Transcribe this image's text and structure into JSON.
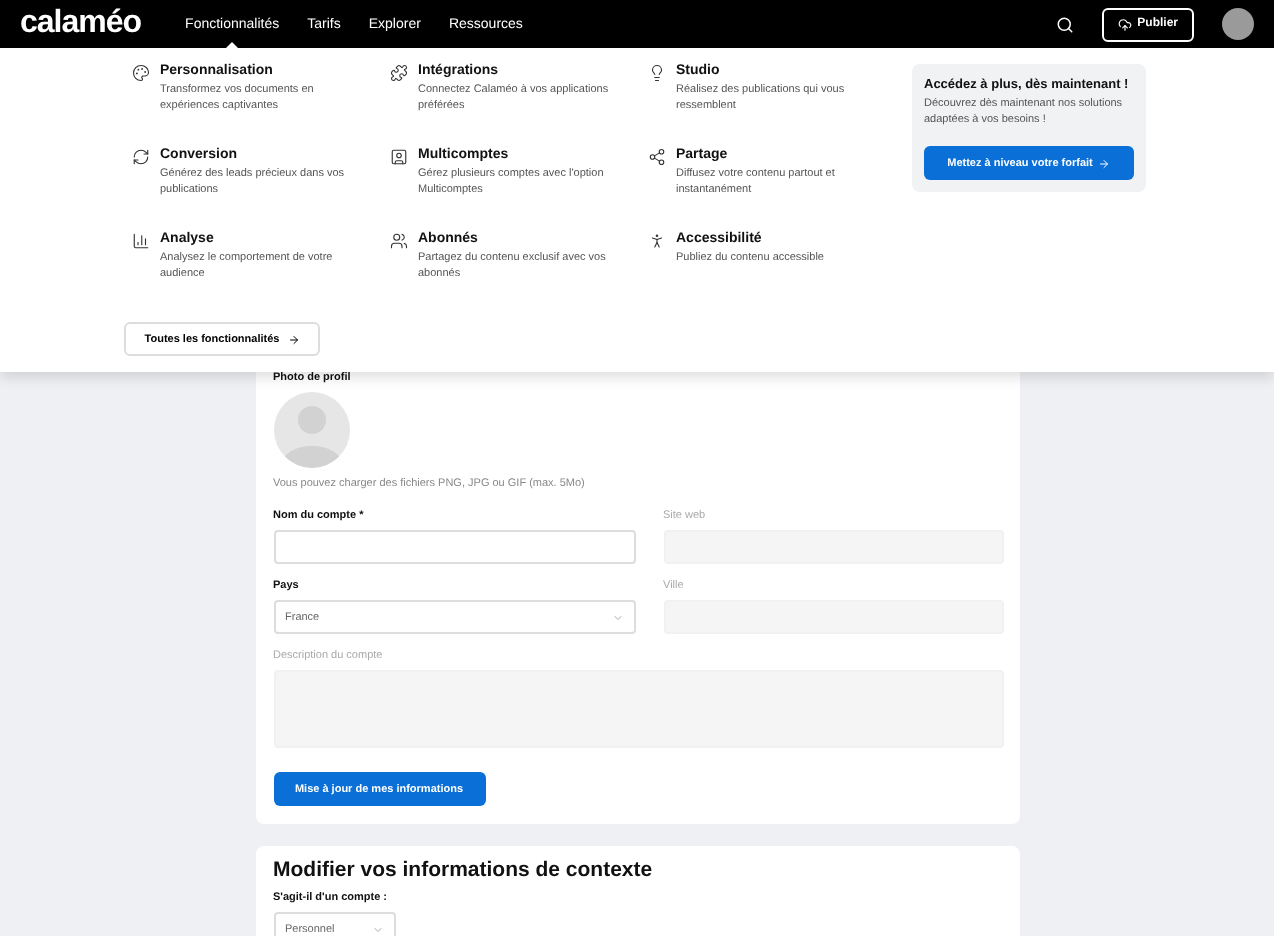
{
  "header": {
    "logo": "calaméo",
    "nav": [
      {
        "label": "Fonctionnalités",
        "selected": true
      },
      {
        "label": "Tarifs",
        "selected": false
      },
      {
        "label": "Explorer",
        "selected": false
      },
      {
        "label": "Ressources",
        "selected": false
      }
    ],
    "publish": "Publier"
  },
  "menu": {
    "columns": [
      [
        {
          "title": "Personnalisation",
          "text": "Transformez vos documents en expériences captivantes"
        },
        {
          "title": "Conversion",
          "text": "Générez des leads précieux dans vos publications"
        },
        {
          "title": "Analyse",
          "text": "Analysez le comportement de votre audience"
        }
      ],
      [
        {
          "title": "Intégrations",
          "text": "Connectez Calaméo à vos applications préférées"
        },
        {
          "title": "Multicomptes",
          "text": "Gérez plusieurs comptes avec l'option Multicomptes"
        },
        {
          "title": "Abonnés",
          "text": "Partagez du contenu exclusif avec vos abonnés"
        }
      ],
      [
        {
          "title": "Studio",
          "text": "Réalisez des publications qui vous ressemblent"
        },
        {
          "title": "Partage",
          "text": "Diffusez votre contenu partout et instantanément"
        },
        {
          "title": "Accessibilité",
          "text": "Publiez du contenu accessible"
        }
      ]
    ],
    "all": "Toutes les fonctionnalités",
    "promo": {
      "title": "Accédez à plus, dès maintenant !",
      "text": "Découvrez dès maintenant nos solutions adaptées à vos besoins !",
      "button": "Mettez à niveau votre forfait"
    }
  },
  "profile": {
    "photo_label": "Photo de profil",
    "photo_hint": "Vous pouvez charger des fichiers PNG, JPG ou GIF (max. 5Mo)",
    "fields": [
      {
        "kind": "input",
        "label": "Nom du compte *",
        "disabled": false
      },
      {
        "kind": "input",
        "label": "Site web",
        "disabled": true
      },
      {
        "kind": "select",
        "label": "Pays",
        "value": "France",
        "disabled": false
      },
      {
        "kind": "input",
        "label": "Ville",
        "disabled": true
      },
      {
        "kind": "textarea",
        "label": "Description du compte",
        "disabled": true
      }
    ],
    "submit": "Mise à jour de mes informations"
  },
  "context": {
    "title": "Modifier vos informations de contexte",
    "label": "S'agit-il d'un compte :",
    "value": "Personnel"
  }
}
